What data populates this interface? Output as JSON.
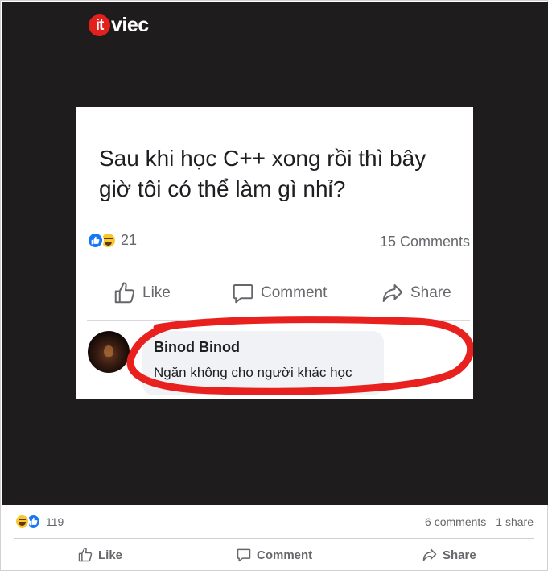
{
  "brand": {
    "logo_badge": "it",
    "logo_text": "viec",
    "accent": "#e2211c"
  },
  "inner_post": {
    "question": "Sau khi học C++ xong rồi thì bây giờ tôi có thể làm gì nhỉ?",
    "reactions": {
      "icons": [
        "like-icon",
        "haha-icon"
      ],
      "count": "21"
    },
    "comments_count": "15 Comments",
    "actions": {
      "like": "Like",
      "comment": "Comment",
      "share": "Share"
    },
    "comment": {
      "author": "Binod Binod",
      "text": "Ngăn không cho người khác học",
      "highlight_color": "#e8211f"
    }
  },
  "post": {
    "reactions": {
      "icons": [
        "haha-icon",
        "like-icon"
      ],
      "count": "119"
    },
    "comments": "6 comments",
    "shares": "1 share",
    "actions": {
      "like": "Like",
      "comment": "Comment",
      "share": "Share"
    }
  },
  "colors": {
    "image_background": "#1f1c1d",
    "facebook_blue": "#1877f2",
    "muted_text": "#65676b"
  }
}
